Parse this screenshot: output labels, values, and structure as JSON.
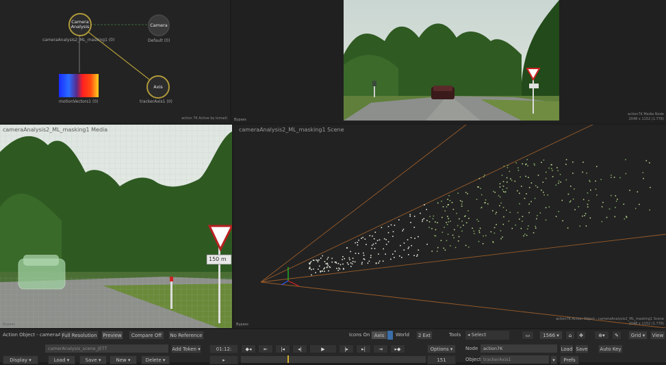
{
  "schematic": {
    "corner_label": "action 7K Active by lomadi",
    "nodes": {
      "camera_analysis": {
        "title": "Camera Analysis",
        "caption": "cameraAnalysis2_ML_masking1 (0)"
      },
      "camera": {
        "title": "Camera",
        "caption": "Default (0)"
      },
      "motion_vectors": {
        "caption": "motionVectors1 (0)"
      },
      "axis": {
        "title": "Axis",
        "caption": "trackerAxis1 (0)"
      }
    }
  },
  "viewer_top": {
    "label": "Bypass",
    "corner_label": "action7K Media Node\n2048 x 1152 (1.778)"
  },
  "viewer_media": {
    "title": "cameraAnalysis2_ML_masking1 Media",
    "label": "Bypass",
    "sign_text": "150 m"
  },
  "viewer_scene": {
    "title": "cameraAnalysis2_ML_masking1 Scene",
    "label": "Bypass",
    "corner_label": "action7K Action Object - cameraAnalysis2_ML_masking1 Scene\n2048 x 1152 (1.778)"
  },
  "toolbar": {
    "row1": {
      "action_object": "Action Object - cameraA",
      "full_resolution": "Full Resolution",
      "preview": "Preview",
      "compare_off": "Compare Off",
      "no_reference": "No Reference",
      "icons_on": "Icons On",
      "axis": "Axis",
      "world": "World",
      "two_d": "2 Ext",
      "tools": "Tools",
      "select": "Select",
      "zoom": "1566",
      "grid": "Grid",
      "view": "View"
    },
    "row2": {
      "field1": "camerAnalysis_scene_JETT",
      "add_token": "Add Token",
      "timecode": "01:12:",
      "options": "Options",
      "node_label": "Node",
      "node_value": "action7K",
      "load": "Load",
      "save": "Save",
      "auto_key": "Auto Key"
    },
    "row3": {
      "display": "Display",
      "load": "Load",
      "save": "Save",
      "new": "New",
      "delete": "Delete",
      "frame_end": "151",
      "object_label": "Object",
      "object_value": "trackerAxis1",
      "prefs": "Prefs"
    },
    "transport_icons": [
      "prev-keyframe-icon",
      "step-back-icon",
      "go-start-icon",
      "prev-frame-icon",
      "play-icon",
      "next-frame-icon",
      "go-end-icon",
      "step-forward-icon",
      "next-keyframe-icon"
    ]
  },
  "colors": {
    "node_ring": "#b09a3a",
    "accent_blue": "#3b6ea8",
    "camera_frustum": "#a8632a",
    "point_cloud": "#b6d48c"
  }
}
